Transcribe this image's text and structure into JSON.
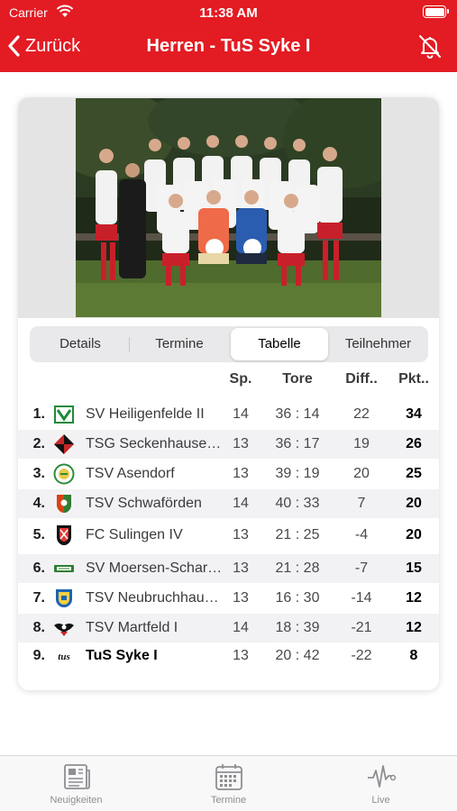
{
  "status": {
    "carrier": "Carrier",
    "time": "11:38 AM"
  },
  "nav": {
    "back_label": "Zurück",
    "title": "Herren - TuS Syke I"
  },
  "segments": [
    {
      "label": "Details",
      "active": false
    },
    {
      "label": "Termine",
      "active": false
    },
    {
      "label": "Tabelle",
      "active": true
    },
    {
      "label": "Teilnehmer",
      "active": false
    }
  ],
  "table": {
    "headers": {
      "games": "Sp.",
      "goals": "Tore",
      "diff": "Diff..",
      "points": "Pkt.."
    },
    "rows": [
      {
        "rank": "1.",
        "logo": "green-white-crest-icon",
        "name": "SV Heiligenfelde II",
        "games": "14",
        "goals": "36 : 14",
        "diff": "22",
        "points": "34"
      },
      {
        "rank": "2.",
        "logo": "red-black-diamond-crest-icon",
        "name": "TSG Seckenhausen-Fahrenhorst",
        "games": "13",
        "goals": "36 : 17",
        "diff": "19",
        "points": "26"
      },
      {
        "rank": "3.",
        "logo": "green-circle-crest-icon",
        "name": "TSV Asendorf",
        "games": "13",
        "goals": "39 : 19",
        "diff": "20",
        "points": "25"
      },
      {
        "rank": "4.",
        "logo": "red-green-shield-crest-icon",
        "name": "TSV Schwaförden",
        "games": "14",
        "goals": "40 : 33",
        "diff": "7",
        "points": "20"
      },
      {
        "rank": "5.",
        "logo": "red-black-fcs-crest-icon",
        "name": "FC Sulingen IV",
        "games": "13",
        "goals": "21 : 25",
        "diff": "-4",
        "points": "20"
      },
      {
        "rank": "6.",
        "logo": "green-banner-crest-icon",
        "name": "SV Moersen-Scharrendorf",
        "games": "13",
        "goals": "21 : 28",
        "diff": "-7",
        "points": "15"
      },
      {
        "rank": "7.",
        "logo": "blue-yellow-shield-crest-icon",
        "name": "TSV Neubruchhausen",
        "games": "13",
        "goals": "16 : 30",
        "diff": "-14",
        "points": "12"
      },
      {
        "rank": "8.",
        "logo": "black-eagle-crest-icon",
        "name": "TSV Martfeld I",
        "games": "14",
        "goals": "18 : 39",
        "diff": "-21",
        "points": "12"
      },
      {
        "rank": "9.",
        "logo": "tus-script-logo-icon",
        "logo_text": "tus",
        "name": "TuS Syke I",
        "games": "13",
        "goals": "20 : 42",
        "diff": "-22",
        "points": "8",
        "highlight": true
      }
    ]
  },
  "tabbar": [
    {
      "label": "Neuigkeiten",
      "icon": "newspaper-icon"
    },
    {
      "label": "Termine",
      "icon": "calendar-icon"
    },
    {
      "label": "Live",
      "icon": "pulse-icon"
    }
  ],
  "colors": {
    "brand_red": "#e31b23",
    "row_alt": "#f2f2f4",
    "tab_gray": "#8e8e93"
  }
}
